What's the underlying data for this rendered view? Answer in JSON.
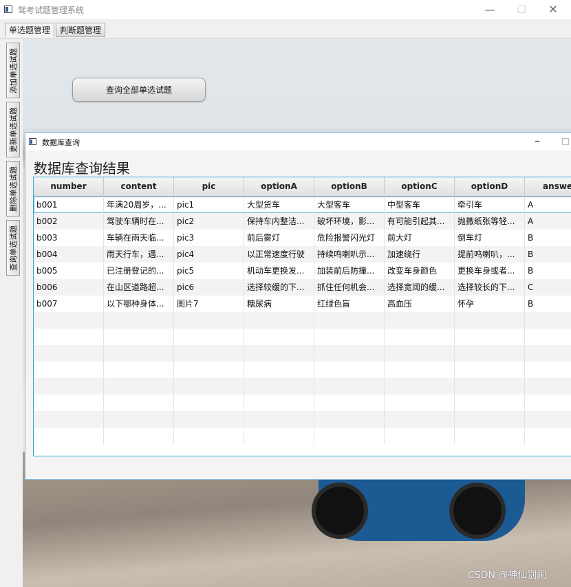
{
  "window": {
    "title": "驾考试题管理系统"
  },
  "tabs": [
    {
      "label": "单选题管理"
    },
    {
      "label": "判断题管理"
    }
  ],
  "side_tabs": [
    {
      "label": "添加单选试题"
    },
    {
      "label": "更新单选试题"
    },
    {
      "label": "删除单选试题"
    },
    {
      "label": "查询单选试题"
    }
  ],
  "main": {
    "query_all_label": "查询全部单选试题"
  },
  "dialog": {
    "title": "数据库查询",
    "heading": "数据库查询结果",
    "columns": [
      "number",
      "content",
      "pic",
      "optionA",
      "optionB",
      "optionC",
      "optionD",
      "answer"
    ],
    "rows": [
      [
        "b001",
        "年满20周岁，...",
        "pic1",
        "大型货车",
        "大型客车",
        "中型客车",
        "牵引车",
        "A"
      ],
      [
        "b002",
        "驾驶车辆时在...",
        "pic2",
        "保持车内整洁...",
        "破坏环境，影...",
        "有可能引起其...",
        "抛撒纸张等轻...",
        "A"
      ],
      [
        "b003",
        "车辆在雨天临...",
        "pic3",
        "前后雾灯",
        "危险报警闪光灯",
        "前大灯",
        "倒车灯",
        "B"
      ],
      [
        "b004",
        "雨天行车，遇...",
        "pic4",
        "以正常速度行驶",
        "持续鸣喇叭示...",
        "加速绕行",
        "提前鸣喇叭，...",
        "B"
      ],
      [
        "b005",
        "已注册登记的...",
        "pic5",
        "机动车更换发...",
        "加装前后防撞...",
        "改变车身颜色",
        "更换车身或者...",
        "B"
      ],
      [
        "b006",
        "在山区道路超...",
        "pic6",
        "选择较缓的下...",
        "抓住任何机会...",
        "选择宽阔的缓...",
        "选择较长的下...",
        "C"
      ],
      [
        "b007",
        "以下哪种身体...",
        "图片7",
        "糖尿病",
        "红绿色盲",
        "高血压",
        "怀孕",
        "B"
      ]
    ],
    "empty_row_count": 8
  },
  "watermark": "CSDN @神仙别闹"
}
